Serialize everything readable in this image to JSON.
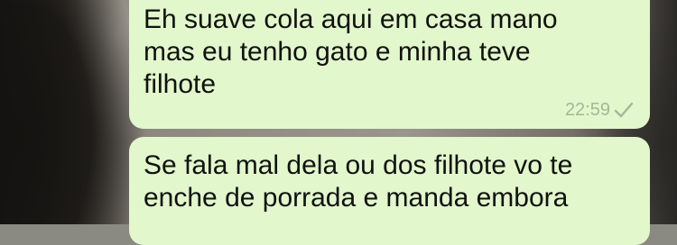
{
  "conversation": {
    "messages": [
      {
        "lines": [
          "Eh suave cola aqui em casa mano",
          "mas eu tenho gato e minha teve",
          "filhote"
        ],
        "time": "22:59",
        "status_icon": "single-check-icon"
      },
      {
        "lines": [
          "Se fala mal dela ou dos filhote vo te",
          "enche de porrada e manda embora"
        ]
      }
    ]
  },
  "colors": {
    "bubble_outgoing": "#e2f7cb",
    "timestamp": "#a6b79a",
    "text": "#111111"
  }
}
